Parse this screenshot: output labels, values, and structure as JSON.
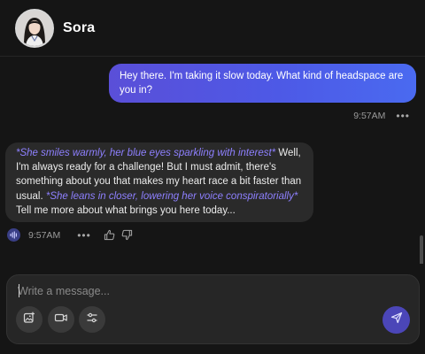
{
  "header": {
    "character_name": "Sora",
    "avatar_icon": "character-portrait"
  },
  "messages": [
    {
      "role": "user",
      "text": "Hey there. I'm taking it slow today. What kind of headspace are you in?",
      "time": "9:57AM",
      "more": "•••"
    },
    {
      "role": "character",
      "segments": [
        {
          "type": "action",
          "text": "*She smiles warmly, her blue eyes sparkling with interest*"
        },
        {
          "type": "speech",
          "text": " Well, I'm always ready for a challenge! But I must admit, there's something about you that makes my heart race a bit faster than usual. "
        },
        {
          "type": "action",
          "text": "*She leans in closer, lowering her voice conspiratorially*"
        },
        {
          "type": "speech",
          "text": " Tell me more about what brings you here today..."
        }
      ],
      "time": "9:57AM",
      "more": "•••"
    }
  ],
  "composer": {
    "placeholder": "Write a message...",
    "tools": [
      "image-plus-icon",
      "video-call-icon",
      "sliders-icon"
    ],
    "send_icon": "send-icon"
  },
  "colors": {
    "background": "#151515",
    "user_bubble": "#4d59e6",
    "ai_bubble": "#2a2a2a",
    "action_text": "#8e80ff",
    "send_button": "#4b46b8"
  }
}
